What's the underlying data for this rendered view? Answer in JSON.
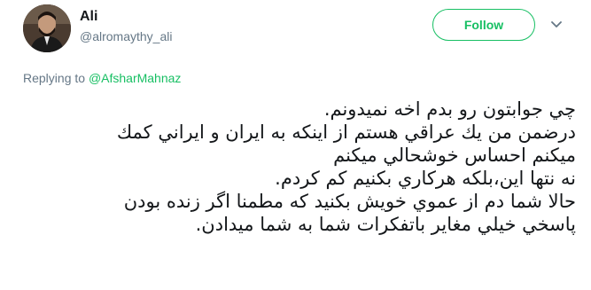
{
  "user": {
    "display_name": "Ali",
    "handle": "@alromaythy_ali"
  },
  "follow_button": {
    "label": "Follow"
  },
  "caret_icon": "chevron-down-icon",
  "reply": {
    "prefix": "Replying to",
    "mention": "@AfsharMahnaz"
  },
  "tweet": {
    "lines": [
      "چي جوابتون رو بدم اخه نميدونم.",
      "درضمن من يك عراقي هستم از اينكه به ايران و ايراني كمك",
      "ميكنم احساس خوشحالي ميكنم",
      "نه نتها اين،بلكه هركاري بكنيم كم كردم.",
      "حالا شما دم از عموي خويش بكنيد كه مطمنا اگر زنده بودن",
      "پاسخي خيلي مغاير باتفكرات شما به شما ميدادن."
    ]
  },
  "colors": {
    "accent": "#17bf63",
    "secondary_text": "#657786",
    "primary_text": "#14171a"
  }
}
